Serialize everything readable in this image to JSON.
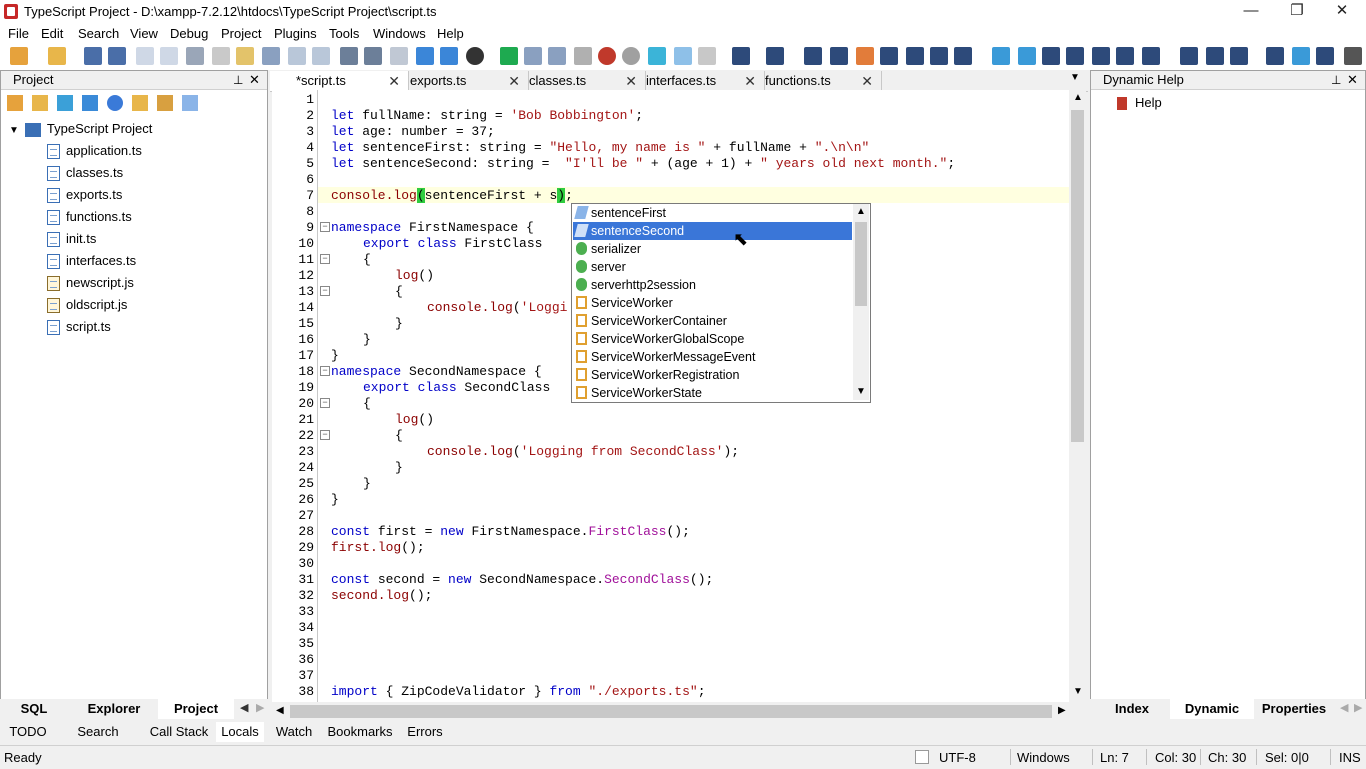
{
  "window": {
    "title": "TypeScript Project - D:\\xampp-7.2.12\\htdocs\\TypeScript Project\\script.ts",
    "minimize": "—",
    "maximize": "❐",
    "close": "✕"
  },
  "menu": [
    "File",
    "Edit",
    "Search",
    "View",
    "Debug",
    "Project",
    "Plugins",
    "Tools",
    "Windows",
    "Help"
  ],
  "project_panel": {
    "title": "Project",
    "root": "TypeScript Project",
    "files": [
      "application.ts",
      "classes.ts",
      "exports.ts",
      "functions.ts",
      "init.ts",
      "interfaces.ts",
      "newscript.js",
      "oldscript.js",
      "script.ts"
    ],
    "bottom_tabs": [
      "SQL",
      "Explorer",
      "Project"
    ]
  },
  "editor_tabs": [
    "*script.ts",
    "exports.ts",
    "classes.ts",
    "interfaces.ts",
    "functions.ts"
  ],
  "code": {
    "lines": [
      "1",
      "2",
      "3",
      "4",
      "5",
      "6",
      "7",
      "8",
      "9",
      "10",
      "11",
      "12",
      "13",
      "14",
      "15",
      "16",
      "17",
      "18",
      "19",
      "20",
      "21",
      "22",
      "23",
      "24",
      "25",
      "26",
      "27",
      "28",
      "29",
      "30",
      "31",
      "32",
      "33",
      "34",
      "35",
      "36",
      "37",
      "38"
    ],
    "l2": {
      "kw": "let",
      "rest": " fullName: string = ",
      "str": "'Bob Bobbington'",
      "end": ";"
    },
    "l3": {
      "kw": "let",
      "rest": " age: number = 37;"
    },
    "l4": {
      "kw": "let",
      "rest": " sentenceFirst: string = ",
      "str": "\"Hello, my name is \"",
      "mid": " + fullName + ",
      "str2": "\".\\n\\n\""
    },
    "l5": {
      "kw": "let",
      "rest": " sentenceSecond: string =  ",
      "str": "\"I'll be \"",
      "mid": " + (age + 1) + ",
      "str2": "\" years old next month.\"",
      "end": ";"
    },
    "l7": {
      "fn": "console.log",
      "open": "(",
      "mid": "sentenceFirst + s",
      "close": ")",
      "end": ";"
    },
    "l9": {
      "kw": "namespace",
      "rest": " FirstNamespace {"
    },
    "l10": {
      "kw": "export class",
      "rest": " FirstClass"
    },
    "l11": "{",
    "l12": {
      "fn": "log",
      "rest": "()"
    },
    "l13": "{",
    "l14": {
      "fn": "console.log",
      "rest": "(",
      "str": "'Loggi"
    },
    "l15": "}",
    "l16": "}",
    "l17": "}",
    "l18": {
      "kw": "namespace",
      "rest": " SecondNamespace {"
    },
    "l19": {
      "kw": "export class",
      "rest": " SecondClass"
    },
    "l20": "{",
    "l21": {
      "fn": "log",
      "rest": "()"
    },
    "l22": "{",
    "l23": {
      "fn": "console.log",
      "rest": "(",
      "str": "'Logging from SecondClass'",
      "end": ");"
    },
    "l24": "}",
    "l25": "}",
    "l26": "}",
    "l28": {
      "kw": "const",
      "rest": " first = ",
      "kw2": "new",
      "mid": " FirstNamespace.",
      "cls": "FirstClass",
      "end": "();"
    },
    "l29": {
      "pre": "first.",
      "fn": "log",
      "end": "();"
    },
    "l31": {
      "kw": "const",
      "rest": " second = ",
      "kw2": "new",
      "mid": " SecondNamespace.",
      "cls": "SecondClass",
      "end": "();"
    },
    "l32": {
      "pre": "second.",
      "fn": "log",
      "end": "();"
    },
    "l38": {
      "kw": "import",
      "rest": " { ZipCodeValidator } ",
      "kw2": "from",
      "str": " \"./exports.ts\"",
      "end": ";"
    }
  },
  "autocomplete": {
    "items": [
      {
        "label": "sentenceFirst",
        "icon": "variable-icon"
      },
      {
        "label": "sentenceSecond",
        "icon": "variable-icon",
        "selected": true
      },
      {
        "label": "serializer",
        "icon": "module-icon"
      },
      {
        "label": "server",
        "icon": "module-icon"
      },
      {
        "label": "serverhttp2session",
        "icon": "module-icon"
      },
      {
        "label": "ServiceWorker",
        "icon": "class-icon"
      },
      {
        "label": "ServiceWorkerContainer",
        "icon": "class-icon"
      },
      {
        "label": "ServiceWorkerGlobalScope",
        "icon": "class-icon"
      },
      {
        "label": "ServiceWorkerMessageEvent",
        "icon": "class-icon"
      },
      {
        "label": "ServiceWorkerRegistration",
        "icon": "class-icon"
      },
      {
        "label": "ServiceWorkerState",
        "icon": "class-icon"
      }
    ]
  },
  "dynamic_help": {
    "title": "Dynamic Help",
    "item": "Help",
    "bottom_tabs": [
      "Index",
      "Dynamic Help",
      "Properties"
    ]
  },
  "bottom_tabs": [
    "TODO",
    "Search Result",
    "Call Stack",
    "Locals",
    "Watch",
    "Bookmarks",
    "Errors"
  ],
  "status": {
    "ready": "Ready",
    "encoding": "UTF-8",
    "line_endings": "Windows",
    "ln": "Ln: 7",
    "col": "Col: 30",
    "ch": "Ch: 30",
    "sel": "Sel: 0|0",
    "mode": "INS"
  },
  "colors": {
    "accent": "#3a76d8",
    "keyword": "#0000c8",
    "string": "#a31515",
    "current_line": "#ffffe0"
  }
}
